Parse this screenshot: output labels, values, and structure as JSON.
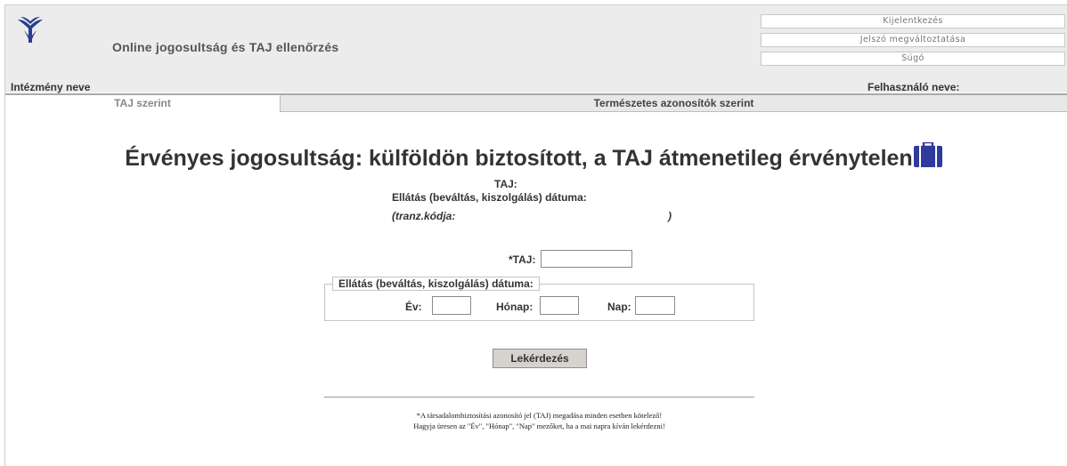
{
  "header": {
    "app_title": "Online jogosultság és TAJ ellenőrzés",
    "institution_label": "Intézmény neve",
    "user_label": "Felhasználó neve:",
    "buttons": {
      "logout": "Kijelentkezés",
      "change_password": "Jelszó megváltoztatása",
      "help": "Súgó"
    },
    "logo_icon": "ministry-logo-icon"
  },
  "tabs": [
    {
      "label": "TAJ szerint",
      "active": true
    },
    {
      "label": "Természetes azonosítók szerint",
      "active": false
    }
  ],
  "result": {
    "title": "Érvényes jogosultság: külföldön biztosított, a TAJ átmenetileg érvénytelen",
    "icon": "suitcase-icon",
    "icon_color": "#2e3a9e",
    "taj_label": "TAJ:",
    "date_label": "Ellátás (beváltás, kiszolgálás) dátuma:",
    "transaction_label": "(tranz.kódja:",
    "transaction_close": ")"
  },
  "form": {
    "taj_label": "*TAJ:",
    "taj_value": "",
    "date_group_legend": "Ellátás (beváltás, kiszolgálás) dátuma:",
    "year_label": "Év:",
    "month_label": "Hónap:",
    "day_label": "Nap:",
    "year_value": "",
    "month_value": "",
    "day_value": "",
    "submit_label": "Lekérdezés"
  },
  "notes": {
    "line1": "*A társadalombiztosítási azonosító jel (TAJ) megadása minden esetben kötelező!",
    "line2": "Hagyja üresen az \"Év\", \"Hónap\", \"Nap\" mezőket, ha a mai napra kíván lekérdezni!"
  },
  "colors": {
    "header_bg": "#ececec",
    "button_bg": "#d6d3ce",
    "logo_blue": "#2a3d8f"
  }
}
